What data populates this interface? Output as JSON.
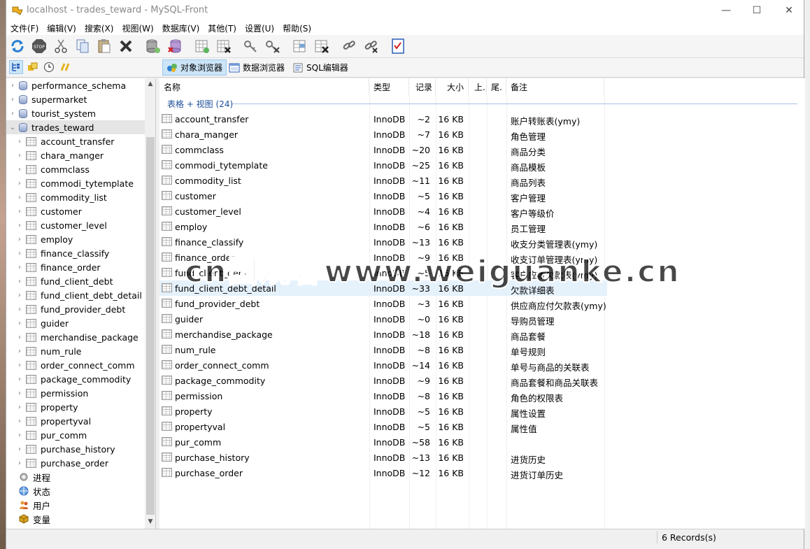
{
  "window": {
    "title": "localhost - trades_teward - MySQL-Front",
    "minimize": "—",
    "maximize": "☐",
    "close": "✕"
  },
  "menu": [
    "文件(F)",
    "编辑(V)",
    "搜索(X)",
    "视图(W)",
    "数据库(V)",
    "其他(T)",
    "设置(U)",
    "帮助(S)"
  ],
  "toolbar_icons": [
    "refresh-icon",
    "stop-icon",
    "cut-icon",
    "copy-icon",
    "paste-icon",
    "delete-icon",
    "db-new-icon",
    "db-delete-icon",
    "table-new-icon",
    "table-delete-icon",
    "key-new-icon",
    "key-delete-icon",
    "field-new-icon",
    "field-delete-icon",
    "link-new-icon",
    "link-delete-icon",
    "checklist-icon"
  ],
  "tabs": {
    "object_browser": "对象浏览器",
    "data_browser": "数据浏览器",
    "sql_editor": "SQL编辑器"
  },
  "tree": {
    "databases": [
      "performance_schema",
      "supermarket",
      "tourist_system",
      "trades_teward"
    ],
    "tables": [
      "account_transfer",
      "chara_manger",
      "commclass",
      "commodi_tytemplate",
      "commodity_list",
      "customer",
      "customer_level",
      "employ",
      "finance_classify",
      "finance_order",
      "fund_client_debt",
      "fund_client_debt_detail",
      "fund_provider_debt",
      "guider",
      "merchandise_package",
      "num_rule",
      "order_connect_comm",
      "package_commodity",
      "permission",
      "property",
      "propertyval",
      "pur_comm",
      "purchase_history",
      "purchase_order"
    ],
    "extras": [
      "进程",
      "状态",
      "用户",
      "变量"
    ]
  },
  "list": {
    "columns": [
      "名称",
      "类型",
      "记录",
      "大小",
      "上.",
      "尾.",
      "备注"
    ],
    "group": "表格 + 视图 (24)",
    "rows": [
      {
        "name": "account_transfer",
        "type": "InnoDB",
        "records": "~2",
        "size": "16 KB",
        "comment": "账户转账表(ymy)"
      },
      {
        "name": "chara_manger",
        "type": "InnoDB",
        "records": "~7",
        "size": "16 KB",
        "comment": "角色管理"
      },
      {
        "name": "commclass",
        "type": "InnoDB",
        "records": "~20",
        "size": "16 KB",
        "comment": "商品分类"
      },
      {
        "name": "commodi_tytemplate",
        "type": "InnoDB",
        "records": "~25",
        "size": "16 KB",
        "comment": "商品模板"
      },
      {
        "name": "commodity_list",
        "type": "InnoDB",
        "records": "~11",
        "size": "16 KB",
        "comment": "商品列表"
      },
      {
        "name": "customer",
        "type": "InnoDB",
        "records": "~5",
        "size": "16 KB",
        "comment": "客户管理"
      },
      {
        "name": "customer_level",
        "type": "InnoDB",
        "records": "~4",
        "size": "16 KB",
        "comment": "客户等级价"
      },
      {
        "name": "employ",
        "type": "InnoDB",
        "records": "~6",
        "size": "16 KB",
        "comment": "员工管理"
      },
      {
        "name": "finance_classify",
        "type": "InnoDB",
        "records": "~13",
        "size": "16 KB",
        "comment": "收支分类管理表(ymy)"
      },
      {
        "name": "finance_order",
        "type": "InnoDB",
        "records": "~9",
        "size": "16 KB",
        "comment": "收支订单管理表(ymy)"
      },
      {
        "name": "fund_client_debt",
        "type": "InnoDB",
        "records": "~5",
        "size": "16 KB",
        "comment": "客户应收欠款表(ymy)"
      },
      {
        "name": "fund_client_debt_detail",
        "type": "InnoDB",
        "records": "~33",
        "size": "16 KB",
        "comment": "欠款详细表"
      },
      {
        "name": "fund_provider_debt",
        "type": "InnoDB",
        "records": "~3",
        "size": "16 KB",
        "comment": "供应商应付欠款表(ymy)"
      },
      {
        "name": "guider",
        "type": "InnoDB",
        "records": "~0",
        "size": "16 KB",
        "comment": "导购员管理"
      },
      {
        "name": "merchandise_package",
        "type": "InnoDB",
        "records": "~18",
        "size": "16 KB",
        "comment": "商品套餐"
      },
      {
        "name": "num_rule",
        "type": "InnoDB",
        "records": "~8",
        "size": "16 KB",
        "comment": "单号规则"
      },
      {
        "name": "order_connect_comm",
        "type": "InnoDB",
        "records": "~14",
        "size": "16 KB",
        "comment": "单号与商品的关联表"
      },
      {
        "name": "package_commodity",
        "type": "InnoDB",
        "records": "~9",
        "size": "16 KB",
        "comment": "商品套餐和商品关联表"
      },
      {
        "name": "permission",
        "type": "InnoDB",
        "records": "~8",
        "size": "16 KB",
        "comment": "角色的权限表"
      },
      {
        "name": "property",
        "type": "InnoDB",
        "records": "~5",
        "size": "16 KB",
        "comment": "属性设置"
      },
      {
        "name": "propertyval",
        "type": "InnoDB",
        "records": "~5",
        "size": "16 KB",
        "comment": "属性值"
      },
      {
        "name": "pur_comm",
        "type": "InnoDB",
        "records": "~58",
        "size": "16 KB",
        "comment": ""
      },
      {
        "name": "purchase_history",
        "type": "InnoDB",
        "records": "~13",
        "size": "16 KB",
        "comment": "进货历史"
      },
      {
        "name": "purchase_order",
        "type": "InnoDB",
        "records": "~12",
        "size": "16 KB",
        "comment": "进货订单历史"
      }
    ]
  },
  "status": "6 Records(s)",
  "watermark": "cn国观客www.weiguanke.cn"
}
